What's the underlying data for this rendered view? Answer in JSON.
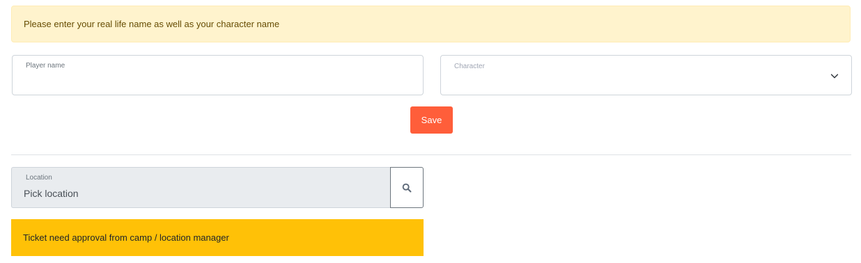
{
  "notice": {
    "text": "Please enter your real life name as well as your character name"
  },
  "player_name": {
    "label": "Player name",
    "value": ""
  },
  "character": {
    "label": "Character",
    "value": ""
  },
  "save_button": {
    "label": "Save"
  },
  "location": {
    "label": "Location",
    "value": "Pick location"
  },
  "warning": {
    "text": "Ticket need approval from camp / location manager"
  },
  "colors": {
    "notice_bg": "#fff3cd",
    "save_button": "#ff5e3a",
    "warning_bg": "#ffc107"
  },
  "icons": {
    "character_dropdown": "chevron-down-icon",
    "location_search": "search-icon"
  }
}
